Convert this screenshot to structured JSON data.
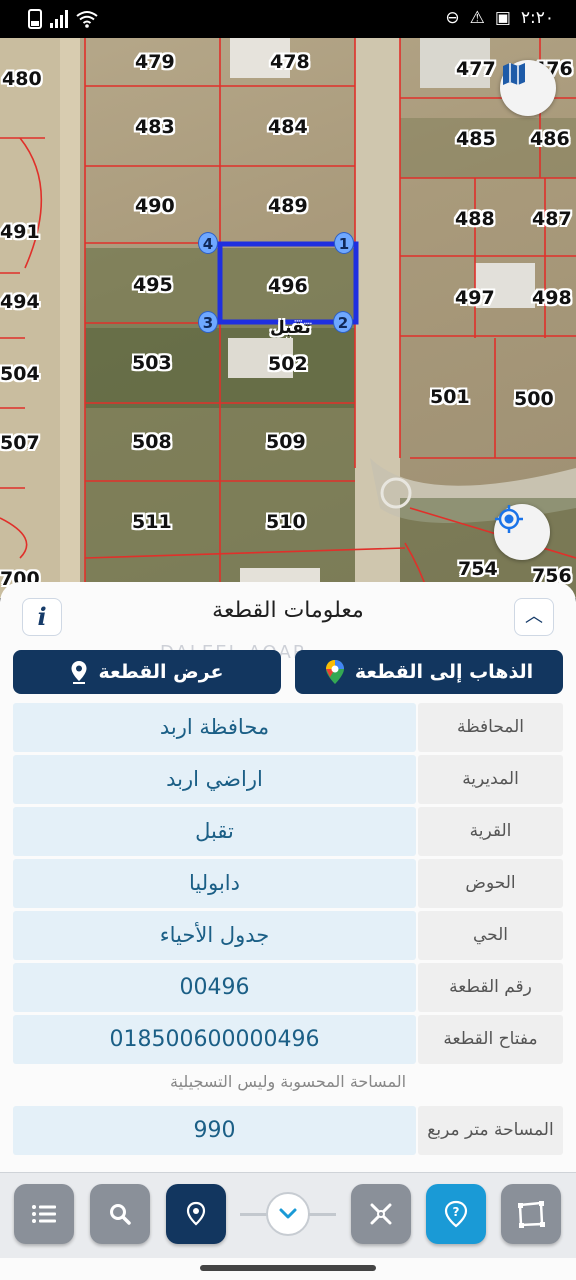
{
  "status_bar": {
    "time": "٢:٢٠"
  },
  "map": {
    "parcels": [
      "480",
      "479",
      "478",
      "477",
      "476",
      "483",
      "484",
      "485",
      "486",
      "490",
      "489",
      "488",
      "487",
      "491",
      "495",
      "496",
      "497",
      "498",
      "494",
      "503",
      "502",
      "504",
      "501",
      "500",
      "507",
      "508",
      "509",
      "511",
      "510",
      "754",
      "756",
      "700"
    ],
    "selected_parcel": "496",
    "vertices": [
      "1",
      "2",
      "3",
      "4"
    ],
    "village_label": "تقبل"
  },
  "panel": {
    "title": "معلومات القطعة",
    "watermark": "DALEEL AQAR",
    "goto_button": "الذهاب إلى القطعة",
    "show_button": "عرض القطعة",
    "fields": [
      {
        "label": "المحافظة",
        "value": "محافظة اربد"
      },
      {
        "label": "المديرية",
        "value": "اراضي اربد"
      },
      {
        "label": "القرية",
        "value": "تقبل"
      },
      {
        "label": "الحوض",
        "value": "دابوليا"
      },
      {
        "label": "الحي",
        "value": "جدول الأحياء"
      },
      {
        "label": "رقم القطعة",
        "value": "00496"
      },
      {
        "label": "مفتاح القطعة",
        "value": "018500600000496"
      }
    ],
    "area_note": "المساحة المحسوبة وليس التسجيلية",
    "area": {
      "label": "المساحة متر مربع",
      "value": "990"
    }
  },
  "colors": {
    "navy": "#12365f",
    "accent_blue": "#1a9ad6",
    "parcel_line": "#e0302a",
    "selection": "#1f2fe0"
  },
  "icons": [
    "map-icon",
    "locate-icon",
    "info-icon",
    "chevron-up-icon",
    "google-maps-pin-icon",
    "location-pin-icon",
    "list-icon",
    "search-icon",
    "pin-icon",
    "chevron-down-icon",
    "measure-icon",
    "help-icon",
    "polygon-icon"
  ]
}
